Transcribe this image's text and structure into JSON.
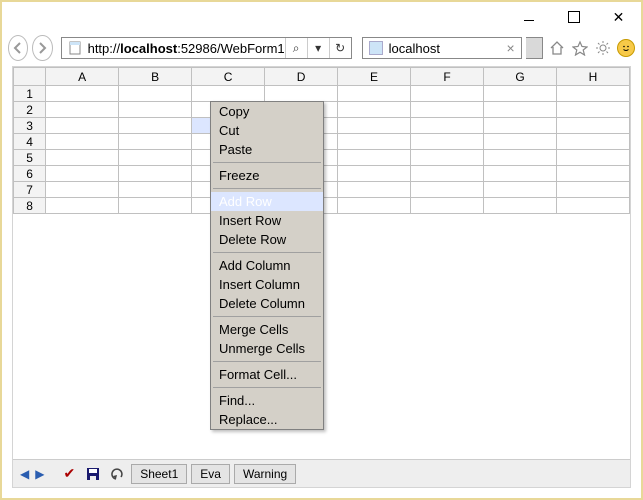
{
  "window": {
    "min": "Minimize",
    "max": "Restore",
    "close": "Close"
  },
  "toolbar": {
    "url_pre": "http://",
    "url_host": "localhost",
    "url_post": ":52986/WebForm1",
    "search_indicator": "⌕",
    "dropdown": "▾",
    "refresh": "↻"
  },
  "tab": {
    "title": "localhost",
    "close": "×"
  },
  "grid": {
    "cols": [
      "A",
      "B",
      "C",
      "D",
      "E",
      "F",
      "G",
      "H"
    ],
    "rows": [
      "1",
      "2",
      "3",
      "4",
      "5",
      "6",
      "7",
      "8"
    ],
    "selected": {
      "row": 3,
      "col": "C"
    }
  },
  "context_menu": {
    "groups": [
      [
        "Copy",
        "Cut",
        "Paste"
      ],
      [
        "Freeze"
      ],
      [
        "Add Row",
        "Insert Row",
        "Delete Row"
      ],
      [
        "Add Column",
        "Insert Column",
        "Delete Column"
      ],
      [
        "Merge Cells",
        "Unmerge Cells"
      ],
      [
        "Format Cell..."
      ],
      [
        "Find...",
        "Replace..."
      ]
    ],
    "highlighted": "Add Row"
  },
  "bottombar": {
    "sheet": "Sheet1",
    "eval": "Eva",
    "warning": "Warning"
  }
}
